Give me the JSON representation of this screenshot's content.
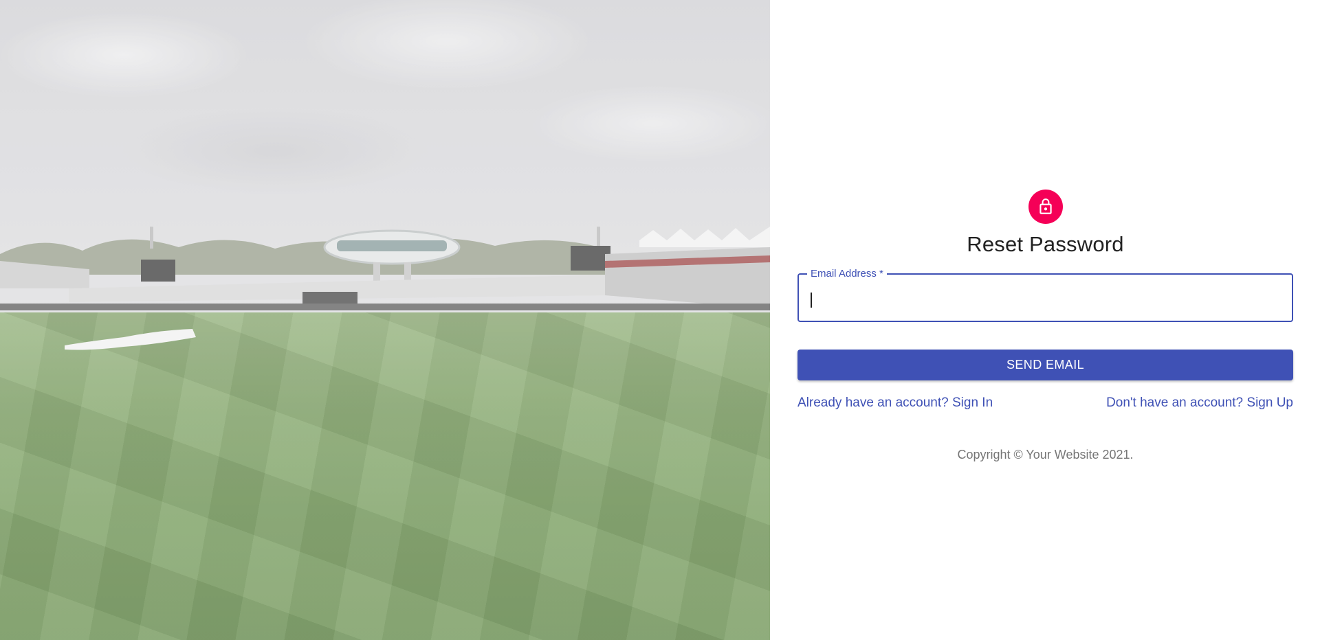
{
  "hero": {
    "icon": "cricket-stadium-image"
  },
  "form": {
    "avatar_icon": "lock-icon",
    "avatar_color": "#f50057",
    "title": "Reset Password",
    "email": {
      "label": "Email Address *",
      "value": ""
    },
    "submit_label": "SEND EMAIL",
    "signin_link": "Already have an account? Sign In",
    "signup_link": "Don't have an account? Sign Up",
    "copyright": "Copyright © Your Website 2021."
  },
  "colors": {
    "primary": "#3f51b5",
    "secondary": "#f50057"
  }
}
